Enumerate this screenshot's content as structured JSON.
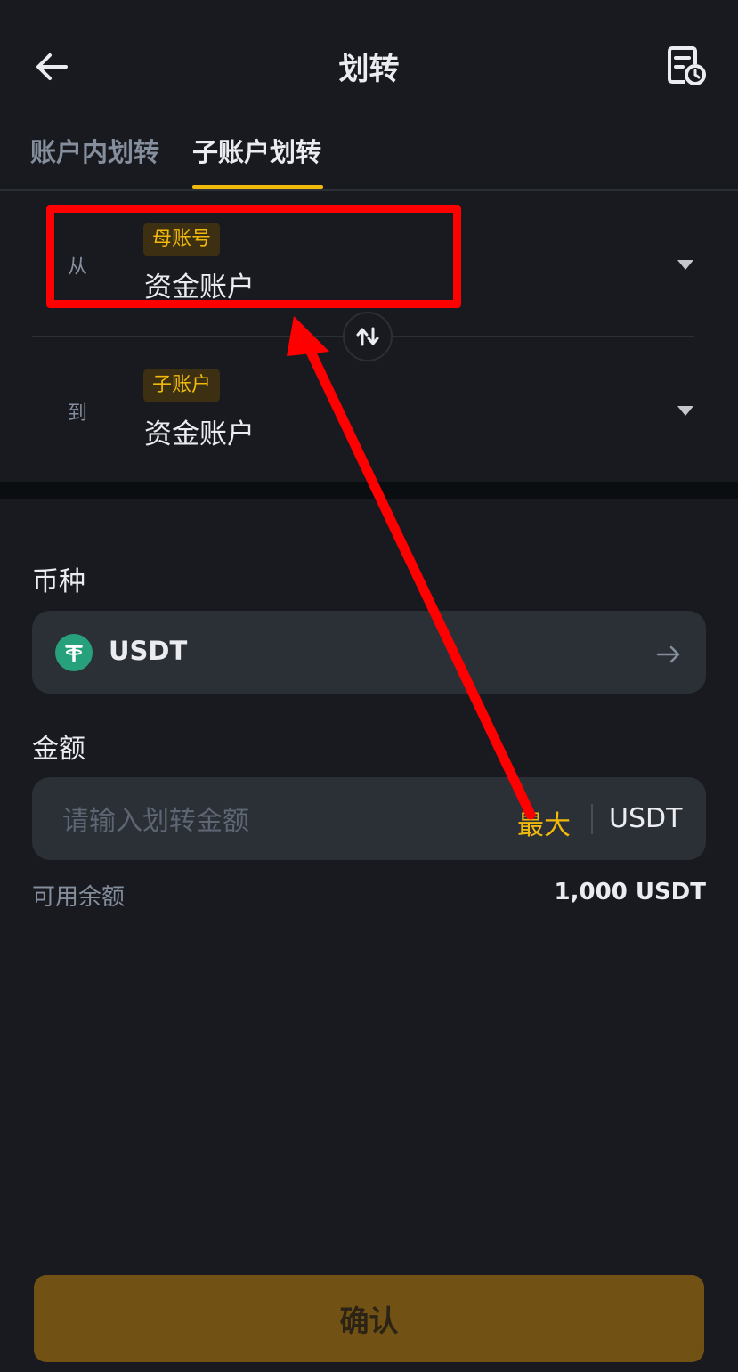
{
  "header": {
    "title": "划转"
  },
  "tabs": [
    {
      "label": "账户内划转"
    },
    {
      "label": "子账户划转"
    }
  ],
  "transfer": {
    "from": {
      "label": "从",
      "badge": "母账号",
      "account": "资金账户"
    },
    "to": {
      "label": "到",
      "badge": "子账户",
      "account": "资金账户"
    }
  },
  "coin": {
    "label": "币种",
    "name": "USDT",
    "icon": "tether-icon"
  },
  "amount": {
    "label": "金额",
    "placeholder": "请输入划转金额",
    "max_label": "最大",
    "unit": "USDT",
    "available_label": "可用余额",
    "available_value": "1,000 USDT"
  },
  "confirm_label": "确认",
  "colors": {
    "background": "#181a20",
    "accent": "#f0b90b",
    "field": "#2b2f36",
    "confirm_bg": "#725214",
    "annotation": "#ff0000",
    "coin": "#26a17b"
  }
}
